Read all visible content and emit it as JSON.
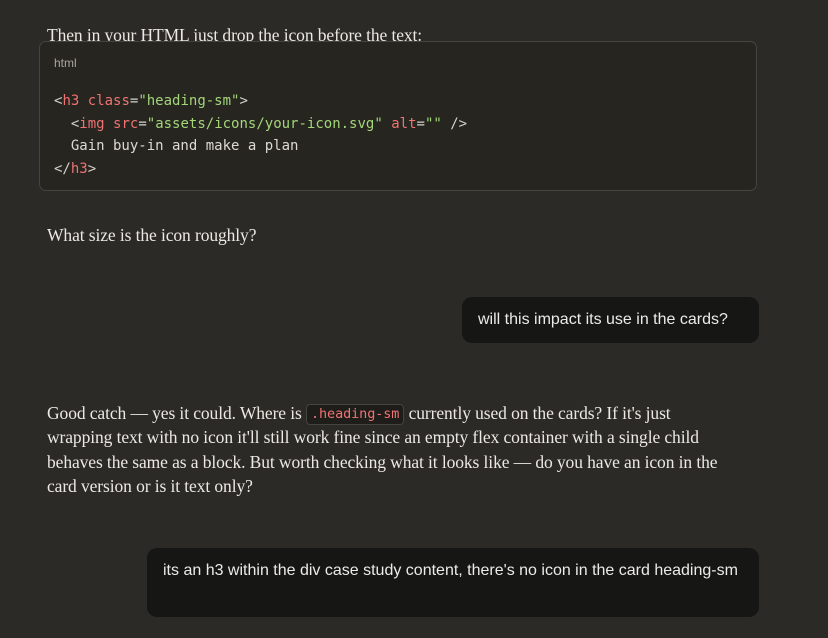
{
  "messages": {
    "intro": "Then in your HTML just drop the icon before the text:",
    "code_block": {
      "language": "html",
      "lines": [
        {
          "open": "<",
          "tag": "h3",
          "sp": " ",
          "attr": "class",
          "eq": "=",
          "str": "\"heading-sm\"",
          "close": ">"
        },
        {
          "indent": "  ",
          "open": "<",
          "tag": "img",
          "sp1": " ",
          "attr1": "src",
          "eq1": "=",
          "str1": "\"assets/icons/your-icon.svg\"",
          "sp2": " ",
          "attr2": "alt",
          "eq2": "=",
          "str2": "\"\"",
          "close": " />"
        },
        {
          "indent": "  ",
          "text": "Gain buy-in and make a plan"
        },
        {
          "open": "</",
          "tag": "h3",
          "close": ">"
        }
      ]
    },
    "question": "What size is the icon roughly?",
    "user_1": "will this impact its use in the cards?",
    "reply": {
      "before": "Good catch — yes it could. Where is ",
      "code": ".heading-sm",
      "after": " currently used on the cards? If it's just wrapping text with no icon it'll still work fine since an empty flex container with a single child behaves the same as a block. But worth checking what it looks like — do you have an icon in the card version or is it text only?"
    },
    "user_2": "its an h3 within the div case study content, there's no icon in the card heading-sm"
  }
}
